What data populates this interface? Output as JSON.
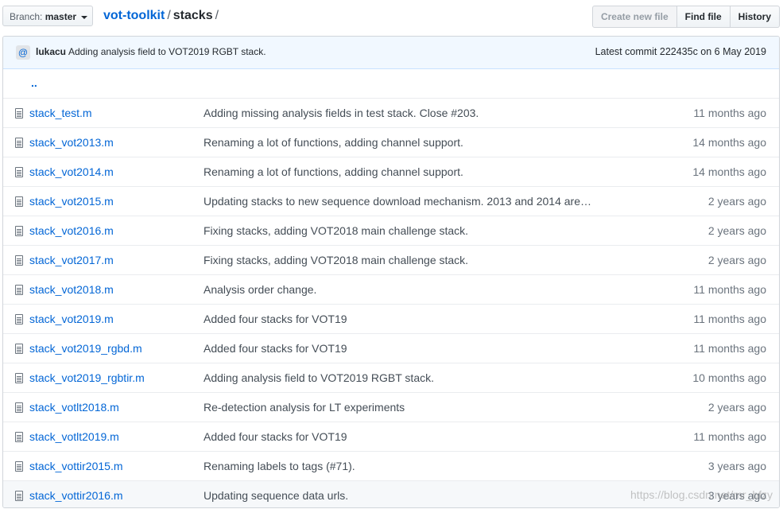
{
  "branch": {
    "label": "Branch:",
    "name": "master"
  },
  "breadcrumb": {
    "repo": "vot-toolkit",
    "sep1": "/",
    "dir": "stacks",
    "sep2": "/"
  },
  "buttons": {
    "create": "Create new file",
    "find": "Find file",
    "history": "History"
  },
  "commit": {
    "author": "lukacu",
    "message": "Adding analysis field to VOT2019 RGBT stack.",
    "latest": "Latest commit 222435c on 6 May 2019"
  },
  "up_dir": "..",
  "files": [
    {
      "name": "stack_test.m",
      "msg_pre": "Adding missing analysis fields in test stack. ",
      "msg_link": "Close",
      "msg_post": " #203.",
      "age": "11 months ago"
    },
    {
      "name": "stack_vot2013.m",
      "msg_pre": "Renaming a lot of functions, adding channel support.",
      "msg_link": "",
      "msg_post": "",
      "age": "14 months ago"
    },
    {
      "name": "stack_vot2014.m",
      "msg_pre": "Renaming a lot of functions, adding channel support.",
      "msg_link": "",
      "msg_post": "",
      "age": "14 months ago"
    },
    {
      "name": "stack_vot2015.m",
      "msg_pre": "Updating stacks to new sequence download mechanism. 2013 and 2014 are…",
      "msg_link": "",
      "msg_post": "",
      "age": "2 years ago"
    },
    {
      "name": "stack_vot2016.m",
      "msg_pre": "Fixing stacks, adding VOT2018 main challenge stack.",
      "msg_link": "",
      "msg_post": "",
      "age": "2 years ago"
    },
    {
      "name": "stack_vot2017.m",
      "msg_pre": "Fixing stacks, adding VOT2018 main challenge stack.",
      "msg_link": "",
      "msg_post": "",
      "age": "2 years ago"
    },
    {
      "name": "stack_vot2018.m",
      "msg_pre": "Analysis order change.",
      "msg_link": "",
      "msg_post": "",
      "age": "11 months ago"
    },
    {
      "name": "stack_vot2019.m",
      "msg_pre": "Added four stacks for VOT19",
      "msg_link": "",
      "msg_post": "",
      "age": "11 months ago"
    },
    {
      "name": "stack_vot2019_rgbd.m",
      "msg_pre": "Added four stacks for VOT19",
      "msg_link": "",
      "msg_post": "",
      "age": "11 months ago"
    },
    {
      "name": "stack_vot2019_rgbtir.m",
      "msg_pre": "Adding analysis field to VOT2019 RGBT stack.",
      "msg_link": "",
      "msg_post": "",
      "age": "10 months ago"
    },
    {
      "name": "stack_votlt2018.m",
      "msg_pre": "Re-detection analysis for LT experiments",
      "msg_link": "",
      "msg_post": "",
      "age": "2 years ago"
    },
    {
      "name": "stack_votlt2019.m",
      "msg_pre": "Added four stacks for VOT19",
      "msg_link": "",
      "msg_post": "",
      "age": "11 months ago"
    },
    {
      "name": "stack_vottir2015.m",
      "msg_pre": "Renaming labels to tags (#71).",
      "msg_link": "",
      "msg_post": "",
      "age": "3 years ago"
    },
    {
      "name": "stack_vottir2016.m",
      "msg_pre": "Updating sequence data urls.",
      "msg_link": "",
      "msg_post": "",
      "age": "3 years ago"
    }
  ],
  "watermark": "https://blog.csdn.net/mr_bfzy"
}
